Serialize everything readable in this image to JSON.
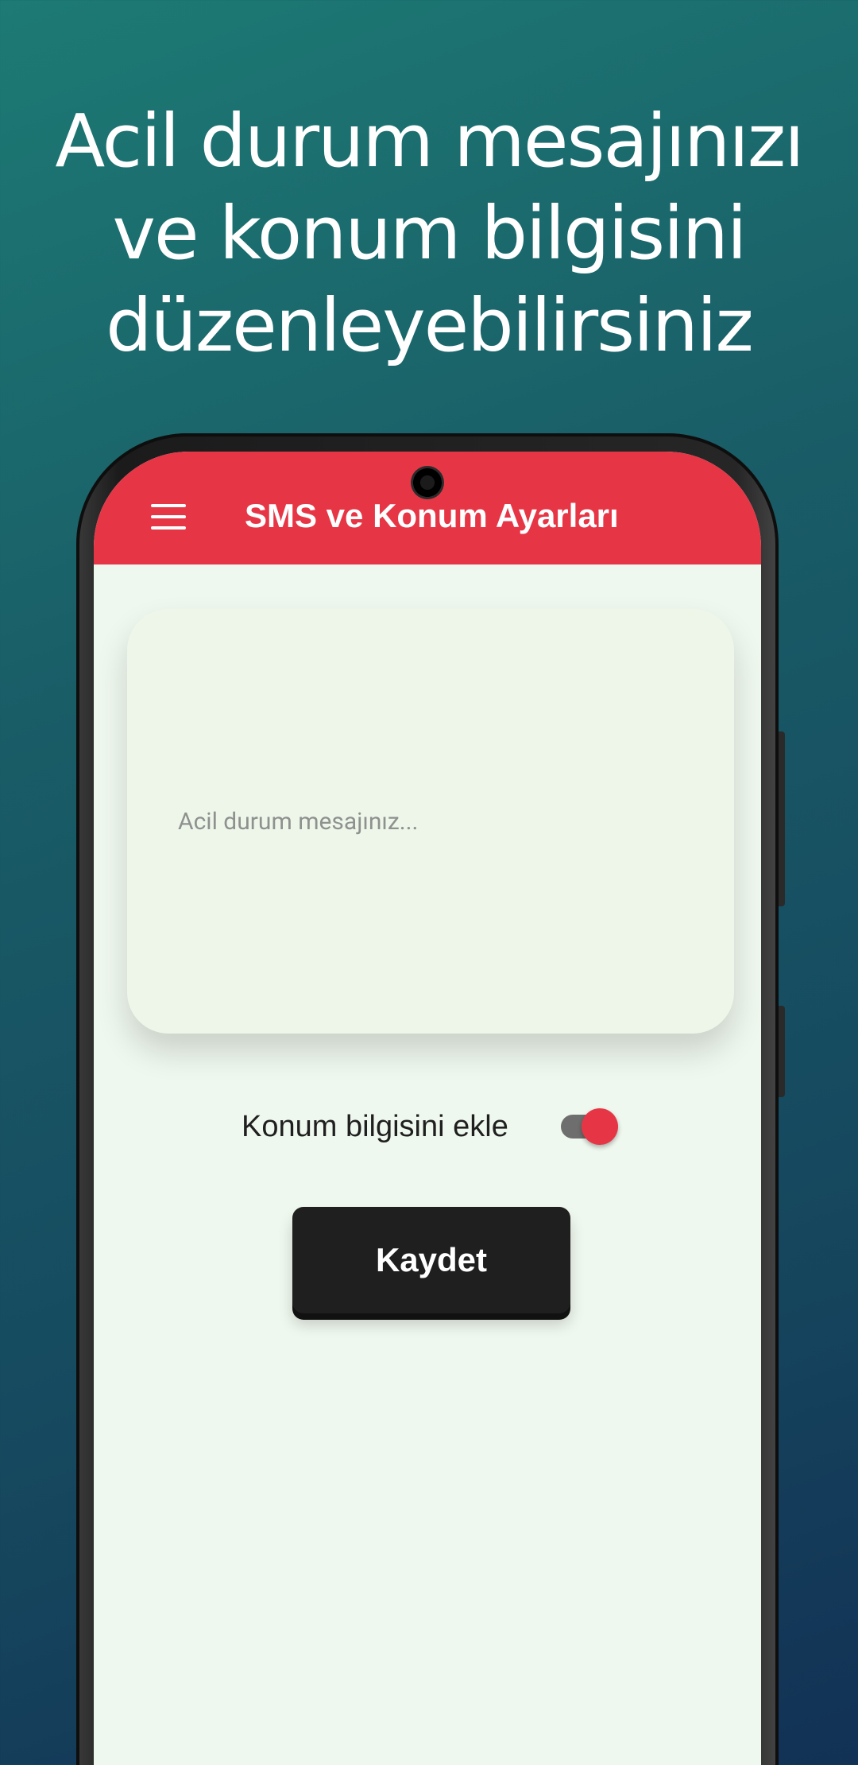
{
  "headline": "Acil durum mesajınızı\nve konum bilgisini\ndüzenleyebilirsiniz",
  "app": {
    "title": "SMS ve Konum Ayarları",
    "menu_icon": "hamburger-menu-icon"
  },
  "message": {
    "value": "",
    "placeholder": "Acil durum mesajınız..."
  },
  "location": {
    "label": "Konum bilgisini ekle",
    "enabled": true
  },
  "save": {
    "label": "Kaydet"
  },
  "colors": {
    "accent": "#e63646",
    "background_top": "#1d7a74",
    "background_bottom": "#123155",
    "screen": "#eff8ee",
    "button": "#1f1f1f"
  }
}
